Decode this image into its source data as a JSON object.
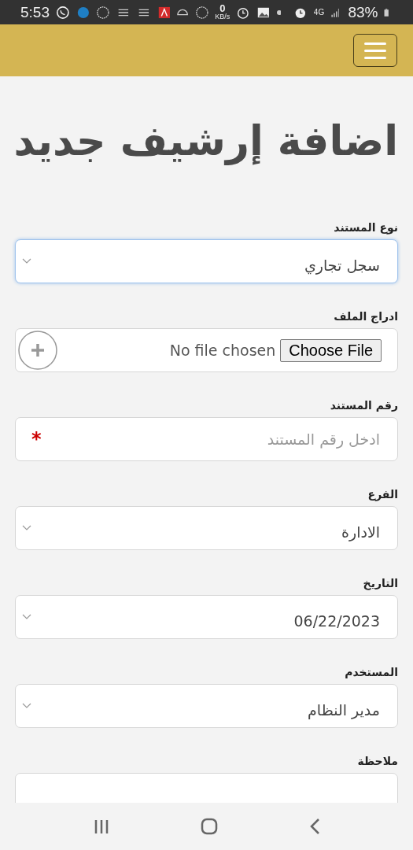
{
  "status_bar": {
    "time": "5:53",
    "speed_value": "0",
    "speed_unit": "KB/s",
    "network": "4G",
    "battery": "83%"
  },
  "header": {
    "menu_open": false
  },
  "title": "اضافة إرشيف جديد",
  "fields": [
    {
      "kind": "select",
      "label": "نوع المستند",
      "value": "سجل تجاري",
      "focused": true
    },
    {
      "kind": "file",
      "label": "ادراج الملف",
      "button": "Choose File",
      "status": "No file chosen",
      "focused": false
    },
    {
      "kind": "text",
      "label": "رقم المستند",
      "placeholder": "ادخل رقم المستند",
      "required_mark": "*",
      "focused": false
    },
    {
      "kind": "select",
      "label": "الفرع",
      "value": "الادارة",
      "focused": false
    },
    {
      "kind": "select",
      "label": "التاريخ",
      "value": "06/22/2023",
      "focused": false
    },
    {
      "kind": "select",
      "label": "المستخدم",
      "value": "مدير النظام",
      "focused": false
    },
    {
      "kind": "textarea",
      "label": "ملاحظة",
      "focused": false
    }
  ]
}
